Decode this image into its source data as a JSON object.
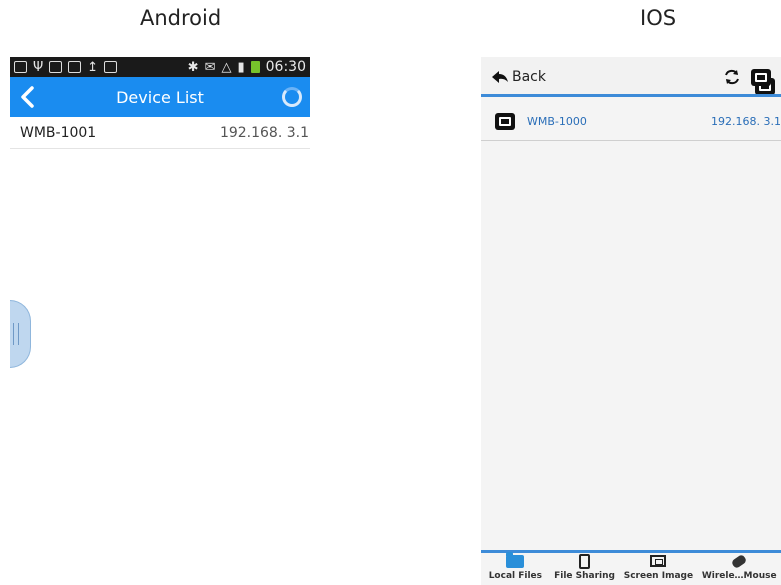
{
  "headings": {
    "android": "Android",
    "ios": "IOS"
  },
  "android": {
    "status_time": "06:30",
    "title": "Device List",
    "devices": [
      {
        "name": "WMB-1001",
        "ip": "192.168. 3.1"
      }
    ]
  },
  "ios": {
    "back_label": "Back",
    "devices": [
      {
        "name": "WMB-1000",
        "ip": "192.168. 3.1"
      }
    ],
    "tabs": [
      {
        "label": "Local Files",
        "icon": "folder-icon"
      },
      {
        "label": "File Sharing",
        "icon": "file-sharing-icon"
      },
      {
        "label": "Screen Image",
        "icon": "screen-image-icon"
      },
      {
        "label": "Wirele…Mouse",
        "icon": "wireless-mouse-icon"
      }
    ]
  },
  "colors": {
    "android_bar": "#1a8cf0",
    "ios_accent": "#3d8bd8",
    "ios_link": "#2a6eb8"
  }
}
